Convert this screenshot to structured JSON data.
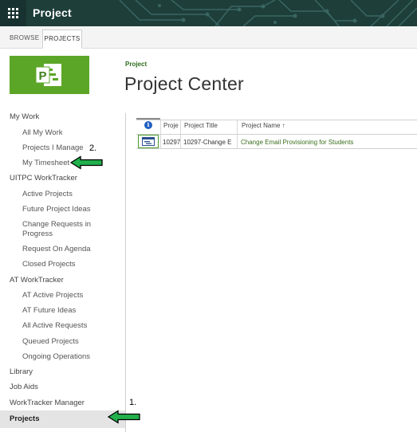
{
  "suite_bar": {
    "title": "Project",
    "waffle_icon": "app-launcher-icon"
  },
  "ribbon": {
    "tabs": [
      {
        "label": "BROWSE",
        "selected": false
      },
      {
        "label": "PROJECTS",
        "selected": true
      }
    ]
  },
  "logo": {
    "icon": "project-logo-icon",
    "letter": "P",
    "color": "#5ca627"
  },
  "header": {
    "breadcrumb": "Project",
    "title": "Project Center"
  },
  "nav": {
    "items": [
      {
        "label": "My Work",
        "level": "head"
      },
      {
        "label": "All My Work",
        "level": "sub"
      },
      {
        "label": "Projects I Manage",
        "level": "sub"
      },
      {
        "label": "My Timesheet",
        "level": "sub"
      },
      {
        "label": "UITPC WorkTracker",
        "level": "head"
      },
      {
        "label": "Active Projects",
        "level": "sub"
      },
      {
        "label": "Future Project Ideas",
        "level": "sub"
      },
      {
        "label": "Change Requests in Progress",
        "level": "sub"
      },
      {
        "label": "Request On Agenda",
        "level": "sub"
      },
      {
        "label": "Closed Projects",
        "level": "sub"
      },
      {
        "label": "AT WorkTracker",
        "level": "head"
      },
      {
        "label": "AT Active Projects",
        "level": "sub"
      },
      {
        "label": "AT Future Ideas",
        "level": "sub"
      },
      {
        "label": "All Active Requests",
        "level": "sub"
      },
      {
        "label": "Queued Projects",
        "level": "sub"
      },
      {
        "label": "Ongoing Operations",
        "level": "sub"
      },
      {
        "label": "Library",
        "level": "head"
      },
      {
        "label": "Job Aids",
        "level": "head"
      },
      {
        "label": "WorkTracker Manager",
        "level": "head"
      },
      {
        "label": "Projects",
        "level": "head",
        "selected": true
      }
    ]
  },
  "grid": {
    "columns": [
      "",
      "Proje",
      "Project Title",
      "Project Name ↑"
    ],
    "info_icon": "info-icon",
    "rows": [
      {
        "icon": "project-row-icon",
        "id": "10297",
        "title": "10297-Change E",
        "name": "Change Email Provisioning for Students"
      }
    ]
  },
  "annotations": {
    "one": "1.",
    "two": "2.",
    "arrow_color": "#22b14c"
  }
}
